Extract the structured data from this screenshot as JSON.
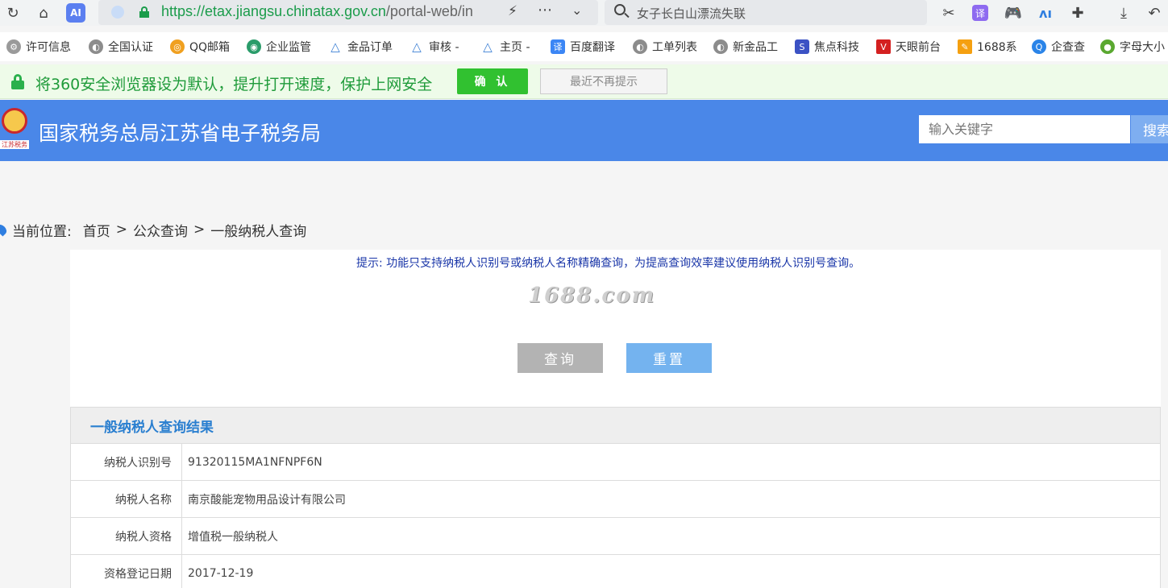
{
  "browser": {
    "url_host": "https://etax.jiangsu.chinatax.gov.cn",
    "url_path": "/portal-web/in",
    "search_text": "女子长白山漂流失联"
  },
  "bookmarks": [
    {
      "label": "许可信息",
      "icon": "gear-icon",
      "color": "#9a9a9a"
    },
    {
      "label": "全国认证",
      "icon": "globe-icon",
      "color": "#8c8c8c"
    },
    {
      "label": "QQ邮箱",
      "icon": "qq-mail-icon",
      "color": "#f0a020"
    },
    {
      "label": "企业监管",
      "icon": "globe-icon",
      "color": "#2a9c6a"
    },
    {
      "label": "金品订单",
      "icon": "triangle-icon",
      "color": "#3b7fd4"
    },
    {
      "label": "审核 -",
      "icon": "triangle-icon",
      "color": "#3b7fd4"
    },
    {
      "label": "主页 -",
      "icon": "triangle-icon",
      "color": "#3b7fd4"
    },
    {
      "label": "百度翻译",
      "icon": "translate-icon",
      "color": "#3b86f5"
    },
    {
      "label": "工单列表",
      "icon": "globe-icon",
      "color": "#8c8c8c"
    },
    {
      "label": "新金品工",
      "icon": "globe-icon",
      "color": "#8c8c8c"
    },
    {
      "label": "焦点科技",
      "icon": "s-logo-icon",
      "color": "#3b52c4"
    },
    {
      "label": "天眼前台",
      "icon": "v-logo-icon",
      "color": "#d42020"
    },
    {
      "label": "1688系",
      "icon": "1688-icon",
      "color": "#f5a010"
    },
    {
      "label": "企查查",
      "icon": "qcc-icon",
      "color": "#2a84e8"
    },
    {
      "label": "字母大小",
      "icon": "frog-icon",
      "color": "#5aa830"
    }
  ],
  "notice": {
    "text": "将360安全浏览器设为默认，提升打开速度，保护上网安全",
    "confirm_label": "确 认",
    "dismiss_label": "最近不再提示"
  },
  "site": {
    "emblem_caption": "江苏税务",
    "title": "国家税务总局江苏省电子税务局",
    "search_placeholder": "输入关键字",
    "search_button": "搜索"
  },
  "breadcrumb": {
    "label": "当前位置:",
    "items": [
      "首页",
      "公众查询",
      "一般纳税人查询"
    ],
    "separator": ">"
  },
  "query": {
    "tip": "提示:   功能只支持纳税人识别号或纳税人名称精确查询，为提高查询效率建议使用纳税人识别号查询。",
    "watermark": "1688.com",
    "query_button": "查询",
    "reset_button": "重置"
  },
  "results": {
    "title": "一般纳税人查询结果",
    "rows": [
      {
        "label": "纳税人识别号",
        "value": "91320115MA1NFNPF6N"
      },
      {
        "label": "纳税人名称",
        "value": "南京酸能宠物用品设计有限公司"
      },
      {
        "label": "纳税人资格",
        "value": "增值税一般纳税人"
      },
      {
        "label": "资格登记日期",
        "value": "2017-12-19"
      }
    ]
  },
  "colors": {
    "header_blue": "#4a87e8",
    "result_title": "#2a7fd0",
    "notice_green": "#1f9b3a"
  }
}
